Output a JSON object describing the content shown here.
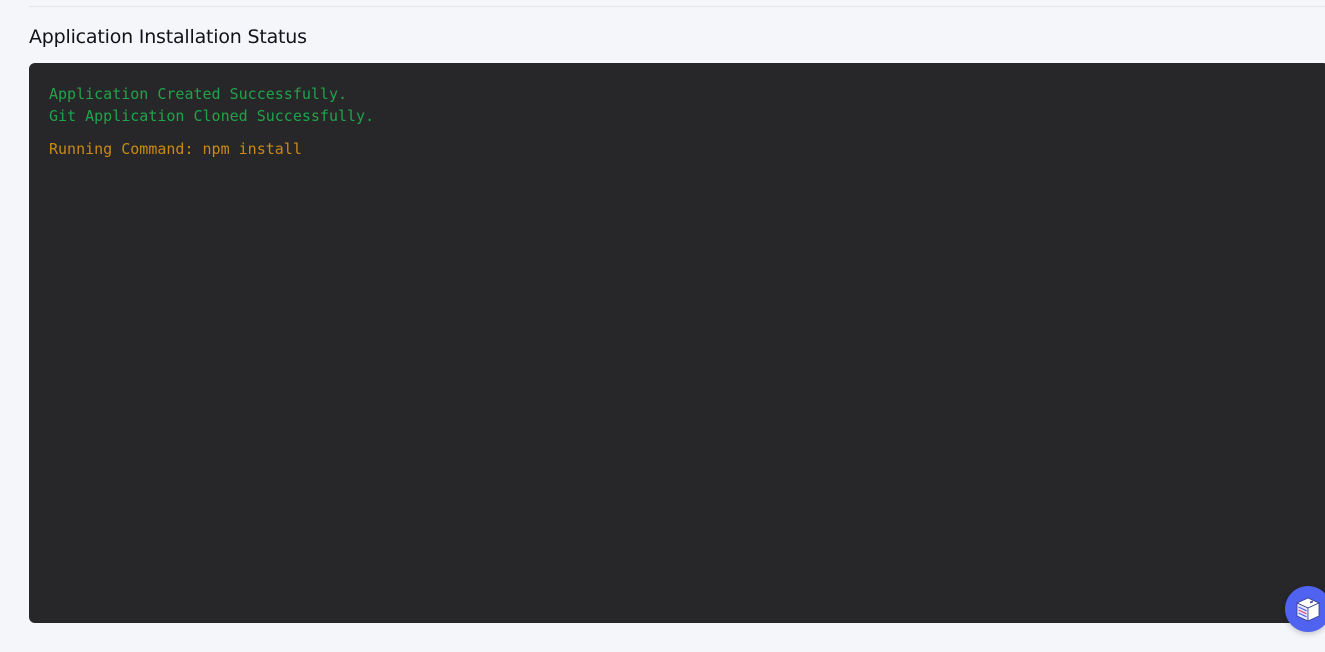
{
  "section": {
    "title": "Application Installation Status"
  },
  "terminal": {
    "lines": [
      {
        "text": "Application Created Successfully.",
        "status": "success"
      },
      {
        "text": "Git Application Cloned Successfully.",
        "status": "success"
      },
      {
        "text": "Running Command: npm install",
        "status": "running"
      }
    ],
    "colors": {
      "background": "#27272a",
      "success": "#1fa34a",
      "running": "#c98a14"
    }
  },
  "widget": {
    "icon": "server-box-icon",
    "color": "#4f63f0"
  }
}
